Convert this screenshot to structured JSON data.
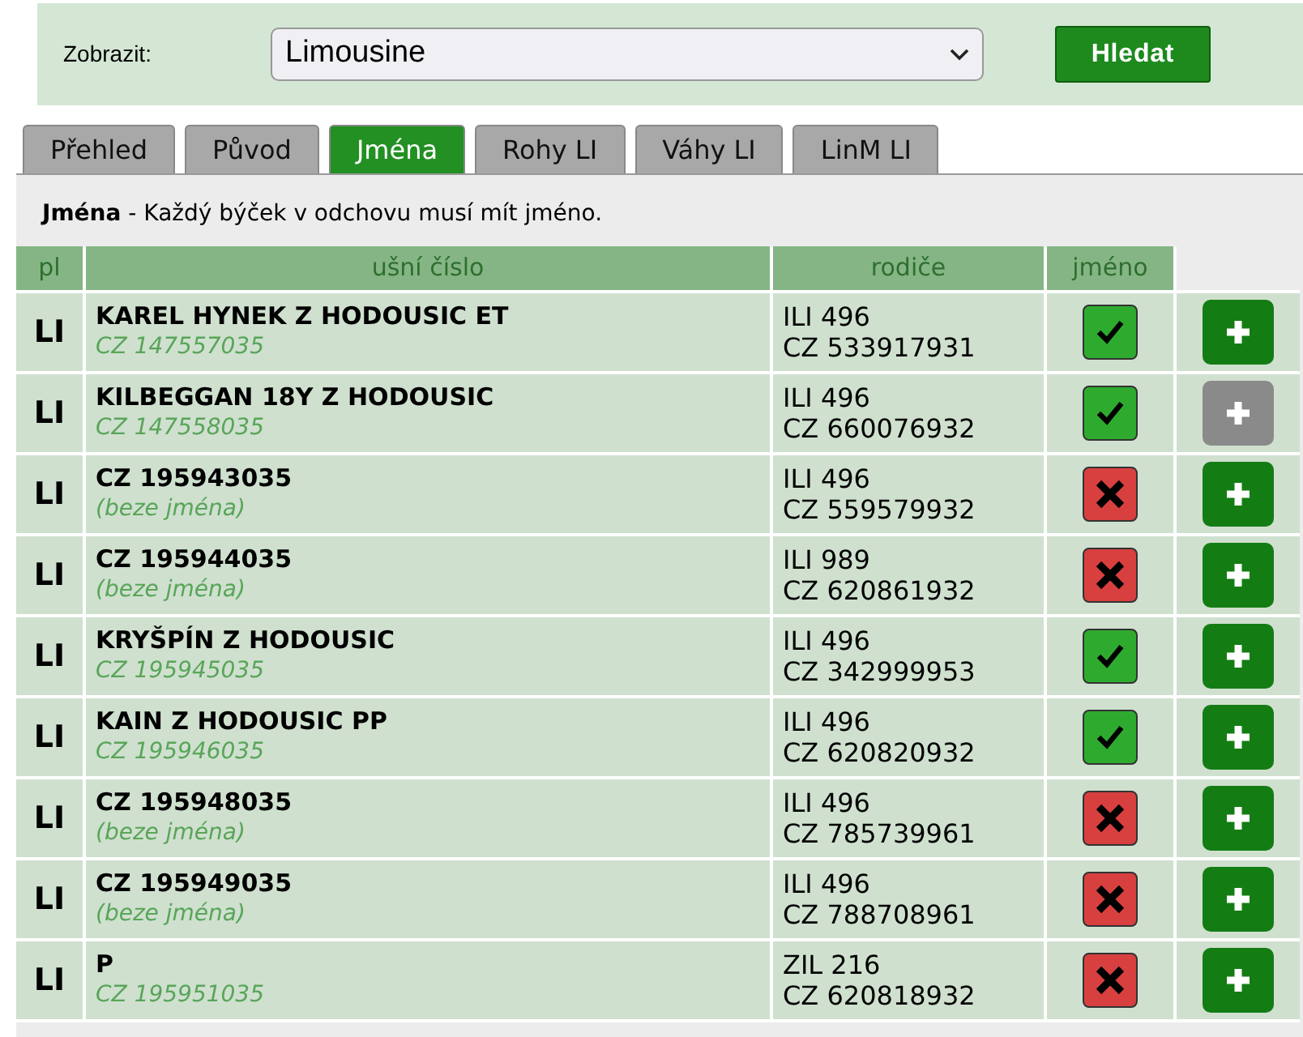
{
  "filter": {
    "label": "Zobrazit:",
    "select_value": "Limousine",
    "button": "Hledat"
  },
  "tabs": [
    {
      "label": "Přehled",
      "selected": false
    },
    {
      "label": "Původ",
      "selected": false
    },
    {
      "label": "Jména",
      "selected": true
    },
    {
      "label": "Rohy LI",
      "selected": false
    },
    {
      "label": "Váhy LI",
      "selected": false
    },
    {
      "label": "LinM LI",
      "selected": false
    }
  ],
  "intro": {
    "title": "Jména",
    "text": " - Každý býček v odchovu musí mít jméno."
  },
  "table": {
    "columns": [
      "pl",
      "ušní číslo",
      "rodiče",
      "jméno"
    ],
    "rows": [
      {
        "pl": "LI",
        "name": "KAREL HYNEK Z HODOUSIC ET",
        "sub": "CZ 147557035",
        "sire": "ILI 496",
        "dam": "CZ 533917931",
        "named": true,
        "add_disabled": false
      },
      {
        "pl": "LI",
        "name": "KILBEGGAN 18Y Z HODOUSIC",
        "sub": "CZ 147558035",
        "sire": "ILI 496",
        "dam": "CZ 660076932",
        "named": true,
        "add_disabled": true
      },
      {
        "pl": "LI",
        "name": "CZ 195943035",
        "sub": "(beze jména)",
        "sire": "ILI 496",
        "dam": "CZ 559579932",
        "named": false,
        "add_disabled": false
      },
      {
        "pl": "LI",
        "name": "CZ 195944035",
        "sub": "(beze jména)",
        "sire": "ILI 989",
        "dam": "CZ 620861932",
        "named": false,
        "add_disabled": false
      },
      {
        "pl": "LI",
        "name": "KRYŠPÍN Z HODOUSIC",
        "sub": "CZ 195945035",
        "sire": "ILI 496",
        "dam": "CZ 342999953",
        "named": true,
        "add_disabled": false
      },
      {
        "pl": "LI",
        "name": "KAIN Z HODOUSIC PP",
        "sub": "CZ 195946035",
        "sire": "ILI 496",
        "dam": "CZ 620820932",
        "named": true,
        "add_disabled": false
      },
      {
        "pl": "LI",
        "name": "CZ 195948035",
        "sub": "(beze jména)",
        "sire": "ILI 496",
        "dam": "CZ 785739961",
        "named": false,
        "add_disabled": false
      },
      {
        "pl": "LI",
        "name": "CZ 195949035",
        "sub": "(beze jména)",
        "sire": "ILI 496",
        "dam": "CZ 788708961",
        "named": false,
        "add_disabled": false
      },
      {
        "pl": "LI",
        "name": "P",
        "sub": "CZ 195951035",
        "sire": "ZIL 216",
        "dam": "CZ 620818932",
        "named": false,
        "add_disabled": false
      }
    ]
  }
}
